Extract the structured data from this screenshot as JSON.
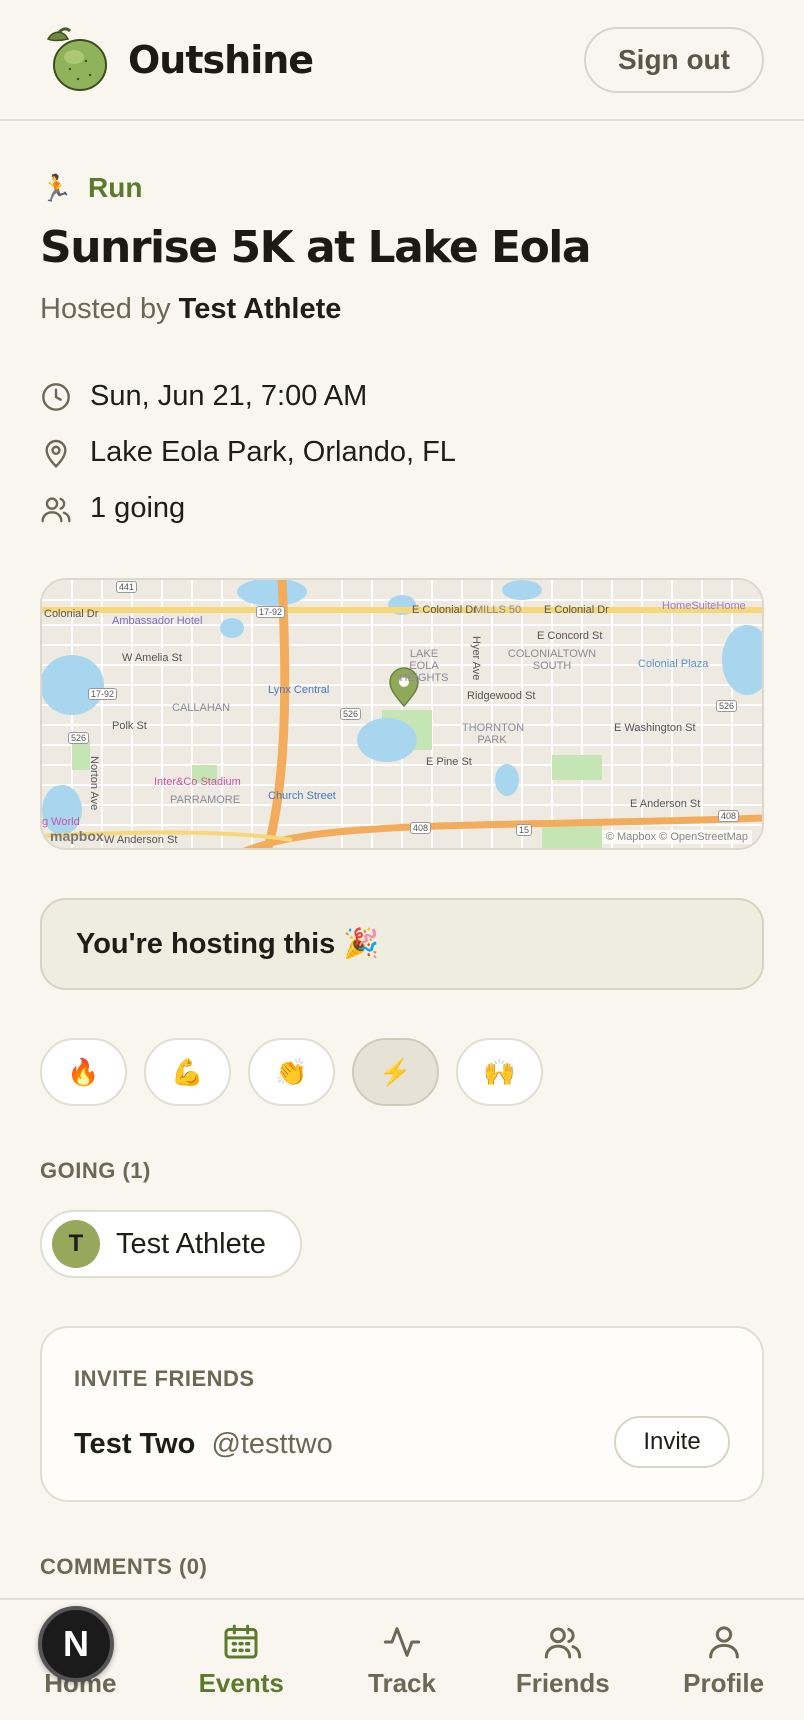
{
  "header": {
    "brand": "Outshine",
    "sign_out_label": "Sign out"
  },
  "event": {
    "category_icon": "running-person-icon",
    "category": "Run",
    "title": "Sunrise 5K at Lake Eola",
    "hosted_prefix": "Hosted by",
    "host_name": "Test Athlete",
    "datetime": "Sun, Jun 21, 7:00 AM",
    "location": "Lake Eola Park, Orlando, FL",
    "going_count": "1 going"
  },
  "map": {
    "labels": {
      "colonial_dr_w": "Colonial Dr",
      "colonial_dr_e1": "E Colonial Dr",
      "mills_50": "MILLS 50",
      "colonial_dr_e2": "E Colonial Dr",
      "homesuitehome": "HomeSuiteHome",
      "ambassador": "Ambassador Hotel",
      "amelia": "W Amelia St",
      "concord": "E Concord St",
      "lake_eola_heights": "LAKE EOLA HEIGHTS",
      "colonialtown": "COLONIALTOWN SOUTH",
      "colonial_plaza": "Colonial Plaza",
      "lynx": "Lynx Central",
      "callahan": "CALLAHAN",
      "ridgewood": "Ridgewood St",
      "polk": "Polk St",
      "washington": "E Washington St",
      "thornton": "THORNTON PARK",
      "pine": "E Pine St",
      "norton": "Norton Ave",
      "hyer": "Hyer Ave",
      "stadium": "Inter&Co Stadium",
      "parramore": "PARRAMORE",
      "church": "Church Street",
      "anderson_e": "E Anderson St",
      "anderson_w": "W Anderson St",
      "world": "g World",
      "shield_441": "441",
      "shield_1792a": "17-92",
      "shield_1792b": "17-92",
      "shield_526a": "526",
      "shield_526b": "526",
      "shield_526c": "526",
      "shield_408a": "408",
      "shield_408b": "408",
      "shield_15": "15"
    },
    "logo": "mapbox",
    "credit": "© Mapbox © OpenStreetMap"
  },
  "hosting_banner": "You're hosting this 🎉",
  "reactions": [
    {
      "emoji": "🔥",
      "active": false
    },
    {
      "emoji": "💪",
      "active": false
    },
    {
      "emoji": "👏",
      "active": false
    },
    {
      "emoji": "⚡",
      "active": true
    },
    {
      "emoji": "🙌",
      "active": false
    }
  ],
  "going": {
    "label": "GOING (1)",
    "attendees": [
      {
        "initial": "T",
        "name": "Test Athlete"
      }
    ]
  },
  "invite": {
    "label": "INVITE FRIENDS",
    "friends": [
      {
        "name": "Test Two",
        "handle": "@testtwo",
        "button": "Invite"
      }
    ]
  },
  "comments": {
    "label": "COMMENTS (0)"
  },
  "nav": {
    "items": [
      {
        "label": "Home",
        "icon": "home-icon"
      },
      {
        "label": "Events",
        "icon": "calendar-icon",
        "active": true
      },
      {
        "label": "Track",
        "icon": "activity-icon"
      },
      {
        "label": "Friends",
        "icon": "users-icon"
      },
      {
        "label": "Profile",
        "icon": "user-icon"
      }
    ],
    "dev_badge": "N"
  },
  "colors": {
    "accent": "#5b7a2c",
    "background": "#f8f6ef",
    "avatar": "#97a85c"
  }
}
